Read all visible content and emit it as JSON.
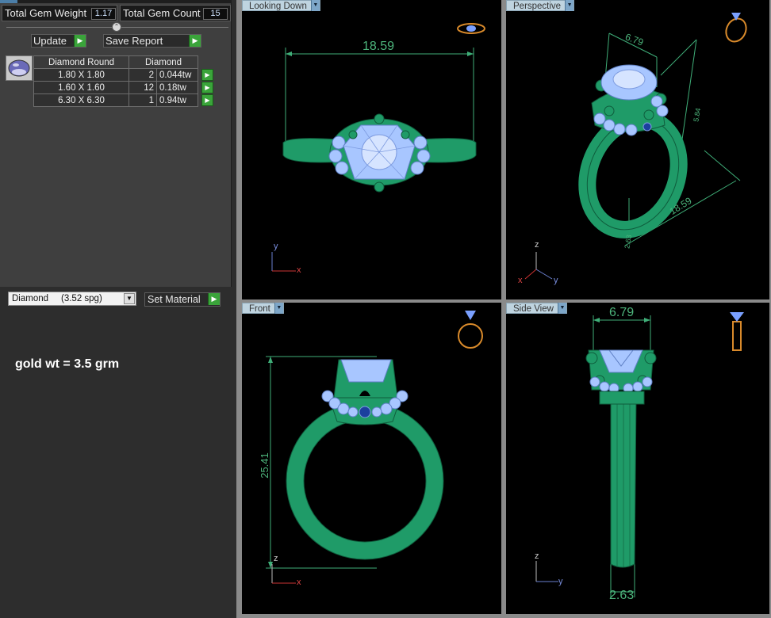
{
  "stats": {
    "gem_weight_label": "Total Gem Weight",
    "gem_weight_value": "1.17",
    "gem_count_label": "Total Gem Count",
    "gem_count_value": "15"
  },
  "actions": {
    "update_label": "Update",
    "save_report_label": "Save Report"
  },
  "gem_table": {
    "headers": [
      "Diamond Round",
      "Diamond"
    ],
    "rows": [
      {
        "size": "1.80 X 1.80",
        "count": "2",
        "weight": "0.044tw"
      },
      {
        "size": "1.60 X 1.60",
        "count": "12",
        "weight": "0.18tw"
      },
      {
        "size": "6.30 X 6.30",
        "count": "1",
        "weight": "0.94tw"
      }
    ]
  },
  "material": {
    "selected": "Diamond     (3.52 spg)",
    "set_label": "Set Material"
  },
  "note": "gold wt = 3.5 grm",
  "viewports": {
    "top_left": {
      "title": "Looking Down",
      "dimension": "18.59",
      "axes": [
        "y",
        "x"
      ]
    },
    "top_right": {
      "title": "Perspective",
      "dimensions": [
        "6.79",
        "18.59",
        "5.84",
        "2.63"
      ],
      "axes": [
        "z",
        "x",
        "y"
      ]
    },
    "bottom_left": {
      "title": "Front",
      "dimension": "25.41",
      "axes": [
        "z",
        "x"
      ]
    },
    "bottom_right": {
      "title": "Side View",
      "dimensions": [
        "6.79",
        "2.63"
      ],
      "axes": [
        "z",
        "y"
      ]
    }
  },
  "colors": {
    "ring_green": "#1f9b68",
    "stone_blue": "#a8c6ff",
    "dimension_green": "#3fae78",
    "panel_bg": "#3f3f3f",
    "play_green": "#3aa43a"
  }
}
